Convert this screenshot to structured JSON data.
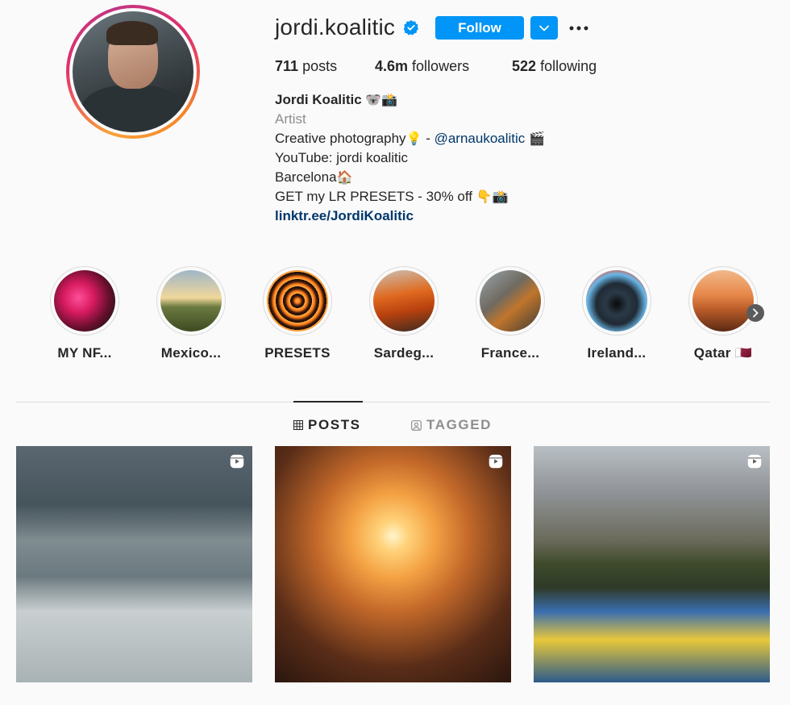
{
  "profile": {
    "username": "jordi.koalitic",
    "follow_label": "Follow",
    "posts_count": "711",
    "posts_label": "posts",
    "followers_count": "4.6m",
    "followers_label": "followers",
    "following_count": "522",
    "following_label": "following",
    "full_name": "Jordi Koalitic",
    "full_name_emoji": "🐨📸",
    "category": "Artist",
    "bio_line1_prefix": "Creative photography",
    "bio_line1_emoji": "💡",
    "bio_line1_dash": " - ",
    "bio_mention": "@arnaukoalitic",
    "bio_line1_suffix_emoji": "🎬",
    "bio_line2": "YouTube: jordi koalitic",
    "bio_line3": "Barcelona",
    "bio_line3_emoji": "🏠",
    "bio_line4": "GET my LR PRESETS - 30% off ",
    "bio_line4_emoji": "👇📸",
    "bio_link": "linktr.ee/JordiKoalitic"
  },
  "highlights": [
    {
      "label": "MY NF..."
    },
    {
      "label": "Mexico..."
    },
    {
      "label": "PRESETS"
    },
    {
      "label": "Sardeg..."
    },
    {
      "label": "France..."
    },
    {
      "label": "Ireland..."
    },
    {
      "label": "Qatar 🇶🇦"
    }
  ],
  "tabs": {
    "posts": "POSTS",
    "tagged": "TAGGED"
  },
  "colors": {
    "accent": "#0095f6",
    "link": "#00376b",
    "muted": "#8e8e8e"
  },
  "icons": [
    "verified-badge-icon",
    "chevron-down-icon",
    "more-options-icon",
    "grid-icon",
    "tagged-icon",
    "reel-icon",
    "next-arrow-icon"
  ]
}
